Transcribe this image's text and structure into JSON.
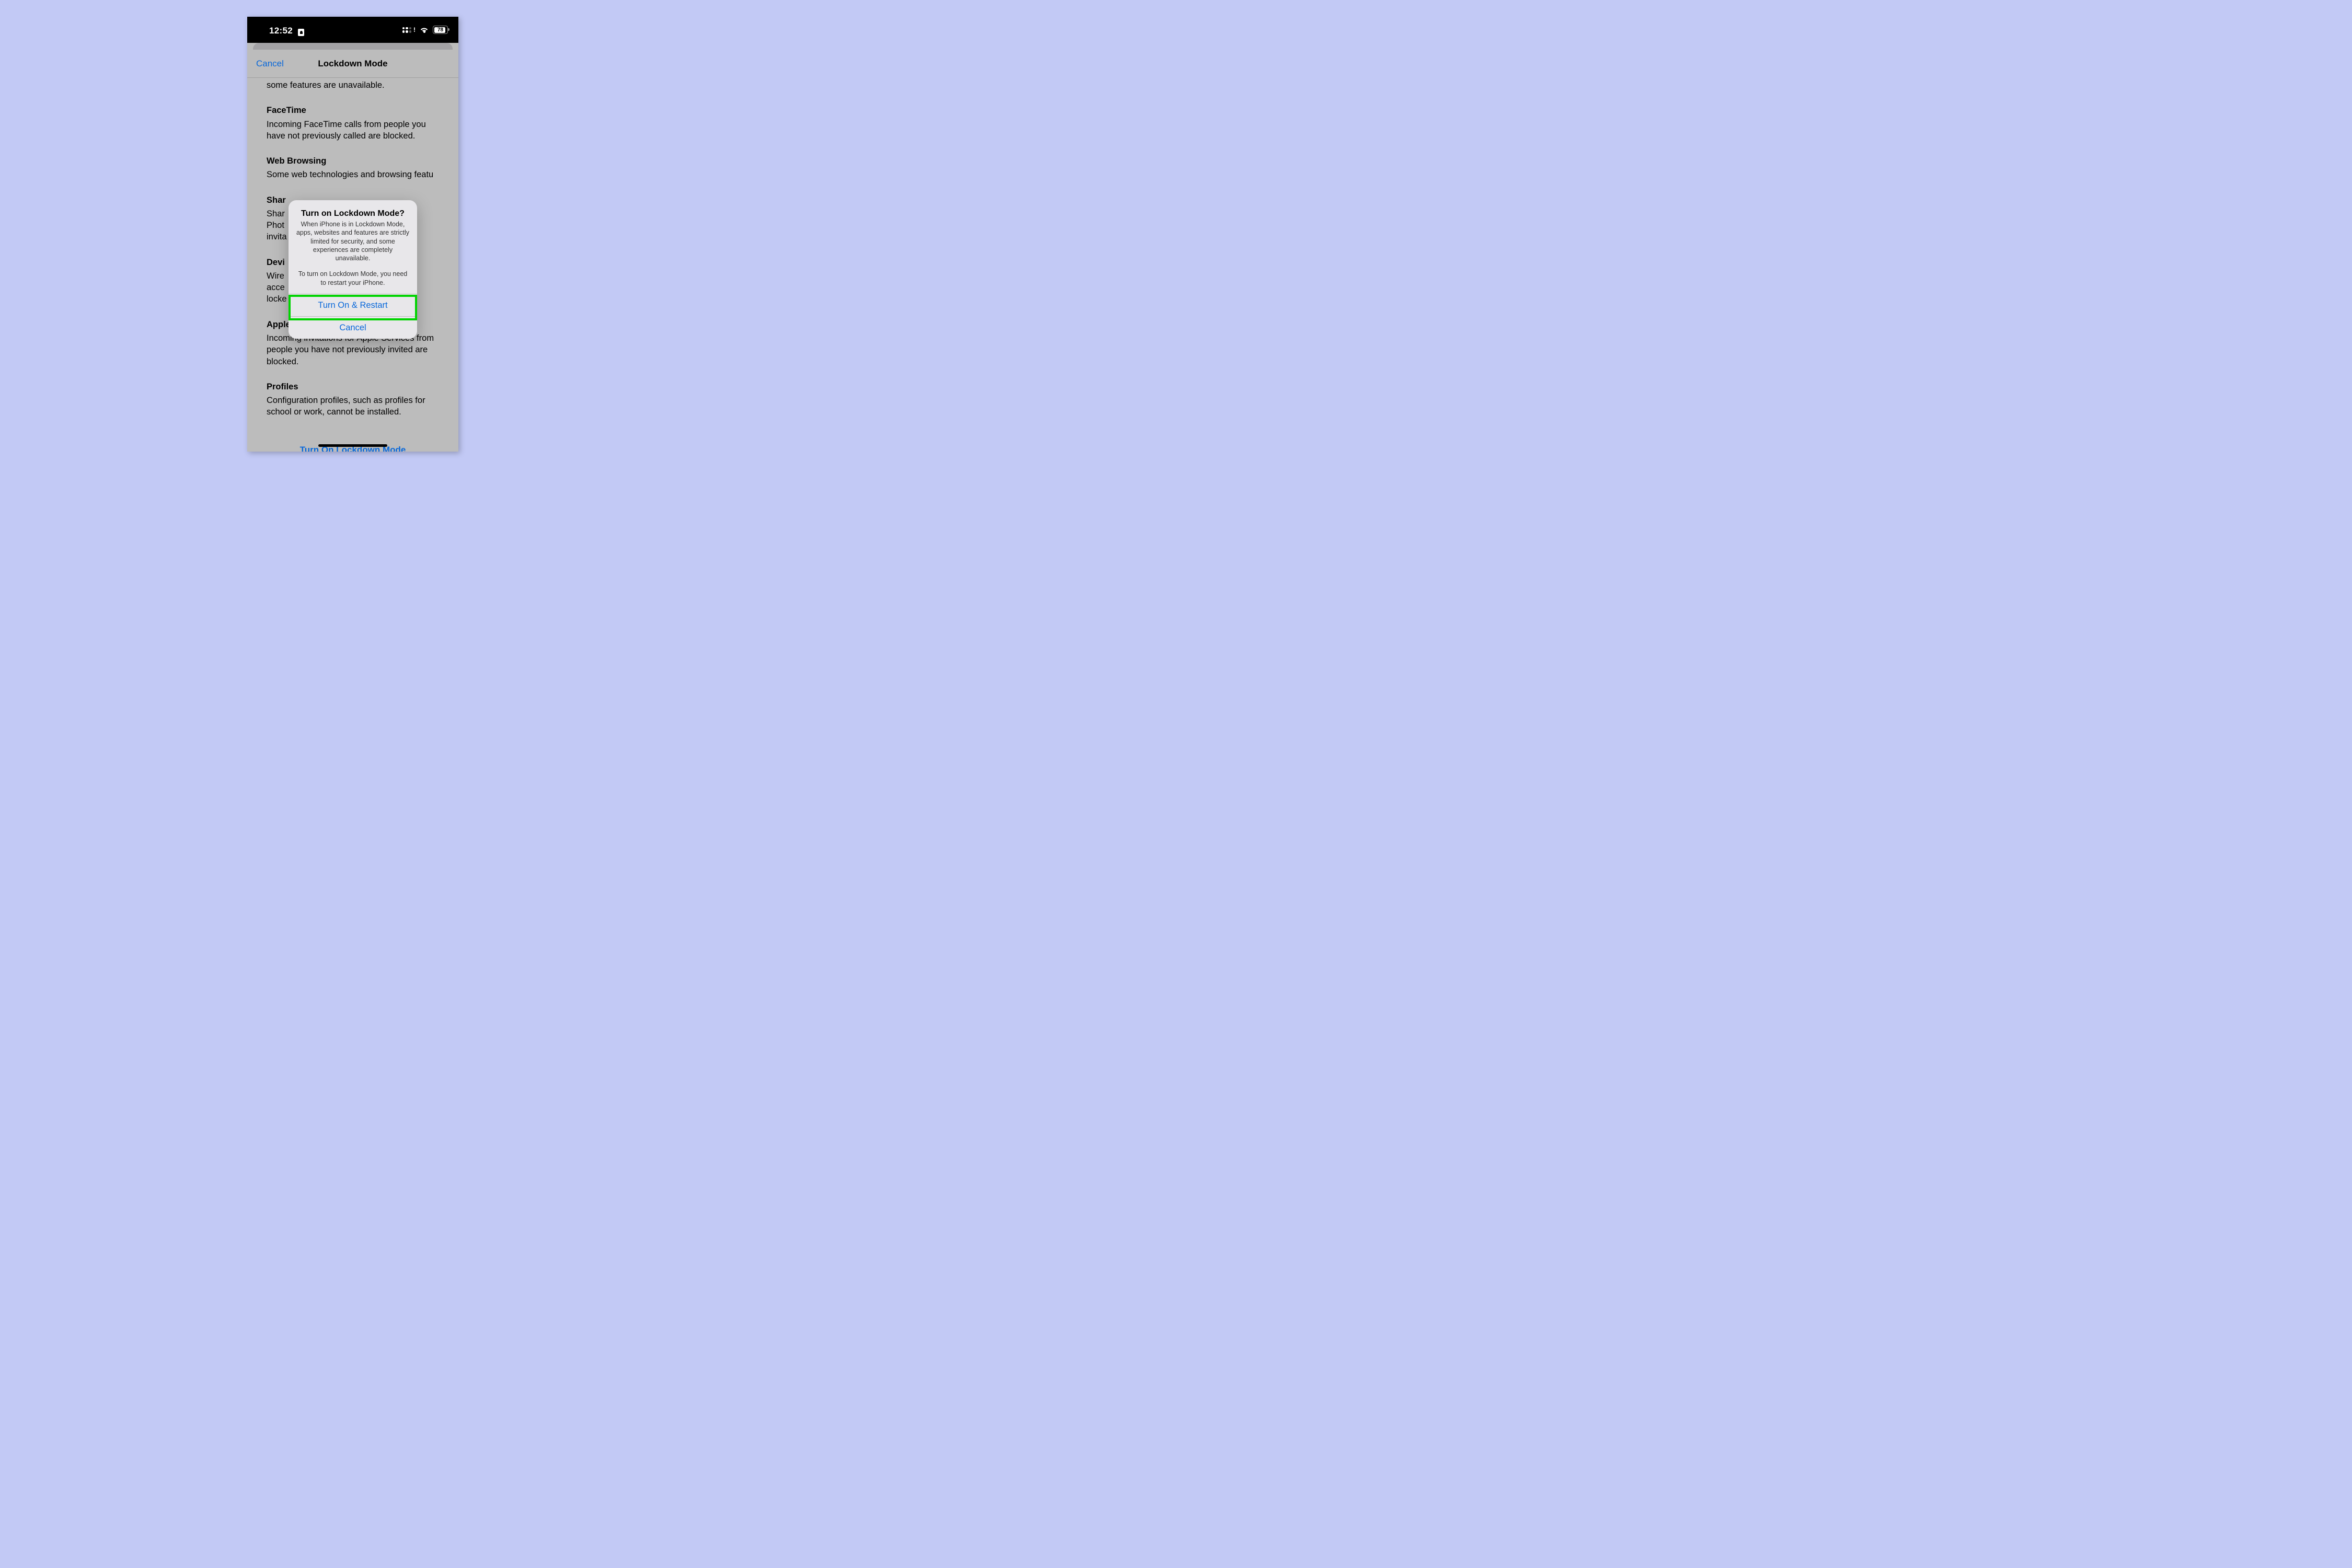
{
  "status": {
    "time": "12:52",
    "battery": "78"
  },
  "nav": {
    "cancel": "Cancel",
    "title": "Lockdown Mode"
  },
  "content": {
    "fragment": "some features are unavailable.",
    "sections": [
      {
        "title": "FaceTime",
        "body": "Incoming FaceTime calls from people you have not previously called are blocked."
      },
      {
        "title": "Web Browsing",
        "body": "Some web technologies and browsing featu"
      },
      {
        "title": "Shar",
        "body": "Shar\nPhot\ninvita"
      },
      {
        "title": "Devi",
        "body": "Wire                                                r\nacce                                               e is\nlocke"
      },
      {
        "title": "Apple Services",
        "body": "Incoming invitations for Apple Services from people you have not previously invited are blocked."
      },
      {
        "title": "Profiles",
        "body": "Configuration profiles, such as profiles for school or work, cannot be installed."
      }
    ],
    "cta": "Turn On Lockdown Mode"
  },
  "alert": {
    "title": "Turn on Lockdown Mode?",
    "body1": "When iPhone is in Lockdown Mode, apps, websites and features are strictly limited for security, and some experiences are completely unavailable.",
    "body2": "To turn on Lockdown Mode, you need to restart your iPhone.",
    "primary": "Turn On & Restart",
    "cancel": "Cancel"
  },
  "highlight_color": "#00d400"
}
